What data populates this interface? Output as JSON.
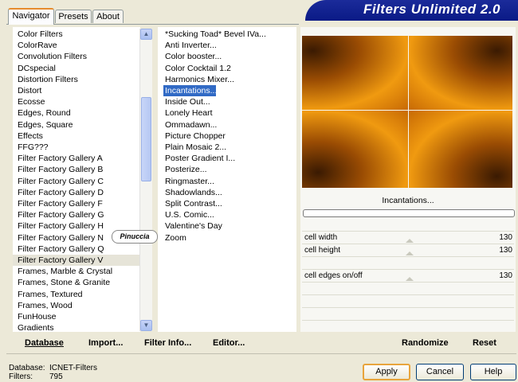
{
  "tabs": [
    "Navigator",
    "Presets",
    "About"
  ],
  "banner": "Filters Unlimited 2.0",
  "categories": [
    "Color Filters",
    "ColorRave",
    "Convolution Filters",
    "DCspecial",
    "Distortion Filters",
    "Distort",
    "Ecosse",
    "Edges, Round",
    "Edges, Square",
    "Effects",
    "FFG???",
    "Filter Factory Gallery A",
    "Filter Factory Gallery B",
    "Filter Factory Gallery C",
    "Filter Factory Gallery D",
    "Filter Factory Gallery F",
    "Filter Factory Gallery G",
    "Filter Factory Gallery H",
    "Filter Factory Gallery N",
    "Filter Factory Gallery Q",
    "Filter Factory Gallery V",
    "Frames, Marble & Crystal",
    "Frames, Stone & Granite",
    "Frames, Textured",
    "Frames, Wood",
    "FunHouse",
    "Gradients"
  ],
  "filters": [
    "*Sucking Toad*  Bevel IVa...",
    "Anti Inverter...",
    "Color booster...",
    "Color Cocktail 1.2",
    "Harmonics Mixer...",
    "Incantations...",
    "Inside Out...",
    "Lonely Heart",
    "Ommadawn...",
    "Picture Chopper",
    "Plain Mosaic 2...",
    "Poster Gradient I...",
    "Posterize...",
    "Ringmaster...",
    "Shadowlands...",
    "Split Contrast...",
    "U.S. Comic...",
    "Valentine's Day",
    "Zoom"
  ],
  "selected_category": "Filter Factory Gallery V",
  "selected_filter": "Incantations...",
  "watermark": "Pinuccia",
  "filter_title": "Incantations...",
  "params": [
    {
      "label": "cell width",
      "value": "130"
    },
    {
      "label": "cell height",
      "value": "130"
    },
    {
      "label": "cell edges on/off",
      "value": "130"
    }
  ],
  "bottom_links": {
    "database": "Database",
    "import": "Import...",
    "filter_info": "Filter Info...",
    "editor": "Editor...",
    "randomize": "Randomize",
    "reset": "Reset"
  },
  "status": {
    "database_label": "Database:",
    "database_value": "ICNET-Filters",
    "filters_label": "Filters:",
    "filters_value": "795"
  },
  "buttons": {
    "apply": "Apply",
    "cancel": "Cancel",
    "help": "Help"
  },
  "colors": {
    "selection": "#316ac5",
    "accent": "#e68b2c",
    "banner": "#0a1a86"
  }
}
